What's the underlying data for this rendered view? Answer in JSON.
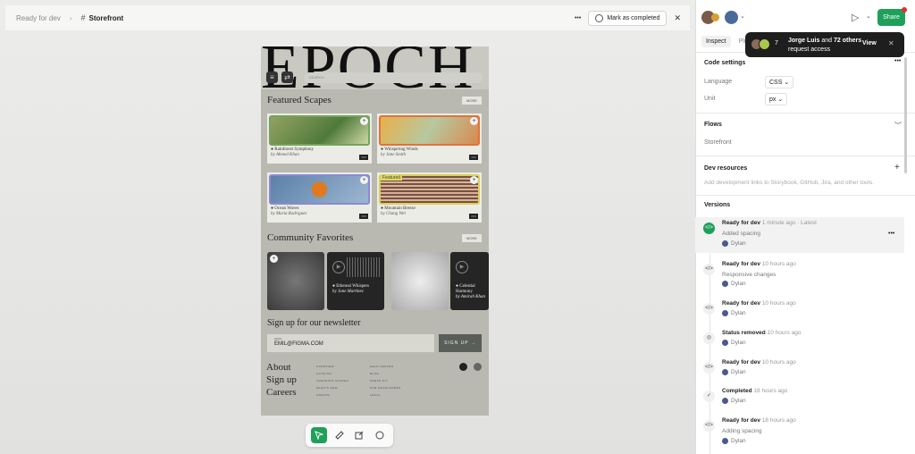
{
  "topbar": {
    "crumb": "Ready for dev",
    "sep": "›",
    "file": "Storefront",
    "more": "•••",
    "mark_label": "Mark as completed",
    "close": "✕"
  },
  "frame": {
    "logo": "EPOCH",
    "search_placeholder": "SEARCH",
    "featured": {
      "title": "Featured Scapes",
      "more": "MORE"
    },
    "cards": [
      {
        "title": "Rainforest Symphony",
        "author": "by Ahmed Khan",
        "color": "#4f7a3a",
        "border": "#73a35c"
      },
      {
        "title": "Whispering Winds",
        "author": "by Jane Smith",
        "color": "#c9a460",
        "border": "#e0733a"
      },
      {
        "title": "Ocean Waves",
        "author": "by Maria Rodriguez",
        "color": "#5b80a8",
        "border": "#8a8ad2"
      },
      {
        "title": "Mountain Breeze",
        "author": "by Chang Wei",
        "color": "#b78a70",
        "border": "#d9d058",
        "tag": "Featured"
      }
    ],
    "community": {
      "title": "Community Favorites",
      "more": "MORE"
    },
    "cf_items": [
      {
        "title": "Ethereal Whispers",
        "author": "by Jane Martinez"
      },
      {
        "title": "Celestial Harmony",
        "author": "by Amirah Khan"
      }
    ],
    "newsletter": {
      "title": "Sign up for our newsletter",
      "email_label": "EMAIL",
      "email_value": "EMIL@FIGMA.COM",
      "button": "SIGN UP →"
    },
    "footer": {
      "main": [
        "About",
        "Sign up",
        "Careers"
      ],
      "col1": [
        "OVERVIEW",
        "CATALOG",
        "TRENDING SCAPES",
        "WHAT'S NEW",
        "CREATE"
      ],
      "col2": [
        "HELP CENTER",
        "BLOG",
        "PRESS KIT",
        "FOR DEVELOPERS",
        "LEGAL"
      ]
    }
  },
  "right": {
    "share": "Share",
    "tabs": [
      "Inspect",
      "Plu"
    ],
    "toast": {
      "count": "7",
      "name": "Jorge Luis",
      "and": "and",
      "others": "72 others",
      "action": "request access",
      "view": "View",
      "close": "✕"
    },
    "code_settings": {
      "title": "Code settings",
      "language_label": "Language",
      "language": "CSS",
      "unit_label": "Unit",
      "unit": "px",
      "more": "•••"
    },
    "flows": {
      "title": "Flows",
      "item": "Storefront"
    },
    "dev_resources": {
      "title": "Dev resources",
      "desc": "Add development links to Storybook, GitHub, Jira, and other tools.",
      "add": "+"
    },
    "versions": {
      "title": "Versions",
      "items": [
        {
          "status": "Ready for dev",
          "time": "1 minute ago · Latest",
          "desc": "Added spacing",
          "user": "Dylan",
          "icon": "</>"
        },
        {
          "status": "Ready for dev",
          "time": "10 hours ago",
          "desc": "Responsive changes",
          "user": "Dylan",
          "icon": "</>"
        },
        {
          "status": "Ready for dev",
          "time": "10 hours ago",
          "desc": "",
          "user": "Dylan",
          "icon": "</>"
        },
        {
          "status": "Status removed",
          "time": "10 hours ago",
          "desc": "",
          "user": "Dylan",
          "icon": "◎"
        },
        {
          "status": "Ready for dev",
          "time": "10 hours ago",
          "desc": "",
          "user": "Dylan",
          "icon": "</>"
        },
        {
          "status": "Completed",
          "time": "18 hours ago",
          "desc": "",
          "user": "Dylan",
          "icon": "✓"
        },
        {
          "status": "Ready for dev",
          "time": "18 hours ago",
          "desc": "Adding spacing",
          "user": "Dylan",
          "icon": "</>"
        }
      ]
    }
  },
  "colors": {
    "accent": "#1fa05a",
    "toast_bg": "#1e1e1e"
  }
}
